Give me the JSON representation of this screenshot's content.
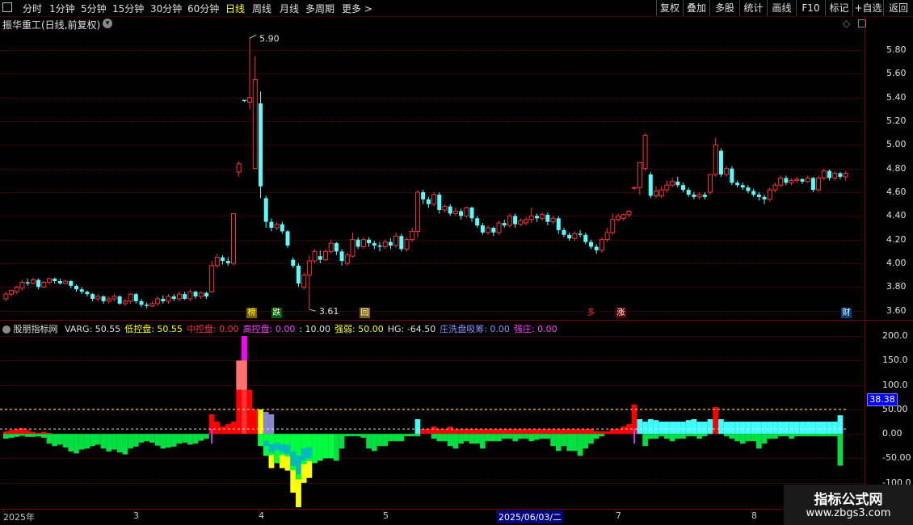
{
  "toolbar": {
    "tabs": [
      "分时",
      "1分钟",
      "5分钟",
      "15分钟",
      "30分钟",
      "60分钟",
      "日线",
      "周线",
      "月线",
      "多周期",
      "更多 >"
    ],
    "active_tab": "日线",
    "right_buttons": [
      "复权",
      "叠加",
      "多股",
      "统计",
      "画线",
      "F10",
      "标记",
      "+自选",
      "返回"
    ]
  },
  "chart_title": "振华重工(日线,前复权)",
  "price_axis": [
    "5.80",
    "5.60",
    "5.40",
    "5.20",
    "5.00",
    "4.80",
    "4.60",
    "4.40",
    "4.20",
    "4.00",
    "3.80",
    "3.60"
  ],
  "indicator": {
    "name": "股朋指标网",
    "items": [
      {
        "label": "VARG: 50.55",
        "color": "#e0e0e0"
      },
      {
        "label": "低控盘: 50.55",
        "color": "#ffff00"
      },
      {
        "label": "中控盘: 0.00",
        "color": "#ff3030"
      },
      {
        "label": "高控盘: 0.00",
        "color": "#ff40ff"
      },
      {
        "label": ": 10.00",
        "color": "#e0e0e0"
      },
      {
        "label": "强弱: 50.00",
        "color": "#ffff00"
      },
      {
        "label": "HG: -64.50",
        "color": "#e0e0e0"
      },
      {
        "label": "庄洗盘吸筹: 0.00",
        "color": "#9090ff"
      },
      {
        "label": "强庄: 0.00",
        "color": "#ff40ff"
      }
    ],
    "axis": [
      "200.0",
      "150.0",
      "100.0",
      "50.00",
      "0.00",
      "-50.00",
      "-100.0"
    ],
    "current_value": "38.38"
  },
  "markers": {
    "high": "5.90",
    "low": "3.61"
  },
  "event_tags": [
    {
      "text": "榜",
      "bg": "#806000",
      "color": "#ffff00"
    },
    {
      "text": "跌",
      "bg": "#006000",
      "color": "#ffffff"
    },
    {
      "text": "回",
      "bg": "#806000",
      "color": "#ffffff"
    },
    {
      "text": "多",
      "bg": "#000000",
      "color": "#ff3030"
    },
    {
      "text": "涨",
      "bg": "#600000",
      "color": "#ffffff"
    },
    {
      "text": "财",
      "bg": "#004080",
      "color": "#ffffff"
    }
  ],
  "date_axis": [
    "2025年",
    "3",
    "4",
    "5",
    "2025/06/03/二",
    "7",
    "8"
  ],
  "watermark": {
    "line1": "指标公式网",
    "line2": "www.zbgs3.com"
  },
  "chart_data": {
    "type": "candlestick",
    "price_range": [
      3.55,
      5.95
    ],
    "candles": [
      [
        3.7,
        3.74,
        3.68,
        3.76
      ],
      [
        3.74,
        3.77,
        3.72,
        3.78
      ],
      [
        3.76,
        3.8,
        3.74,
        3.81
      ],
      [
        3.79,
        3.84,
        3.77,
        3.86
      ],
      [
        3.84,
        3.83,
        3.81,
        3.87
      ],
      [
        3.83,
        3.86,
        3.82,
        3.88
      ],
      [
        3.86,
        3.8,
        3.78,
        3.87
      ],
      [
        3.8,
        3.84,
        3.79,
        3.85
      ],
      [
        3.84,
        3.87,
        3.82,
        3.88
      ],
      [
        3.87,
        3.85,
        3.83,
        3.88
      ],
      [
        3.85,
        3.83,
        3.82,
        3.87
      ],
      [
        3.83,
        3.85,
        3.82,
        3.86
      ],
      [
        3.85,
        3.81,
        3.79,
        3.86
      ],
      [
        3.81,
        3.78,
        3.76,
        3.82
      ],
      [
        3.78,
        3.76,
        3.74,
        3.8
      ],
      [
        3.76,
        3.74,
        3.72,
        3.77
      ],
      [
        3.74,
        3.7,
        3.68,
        3.75
      ],
      [
        3.7,
        3.72,
        3.68,
        3.74
      ],
      [
        3.72,
        3.68,
        3.66,
        3.73
      ],
      [
        3.68,
        3.7,
        3.66,
        3.72
      ],
      [
        3.7,
        3.72,
        3.68,
        3.74
      ],
      [
        3.72,
        3.66,
        3.65,
        3.73
      ],
      [
        3.66,
        3.68,
        3.64,
        3.7
      ],
      [
        3.68,
        3.74,
        3.66,
        3.75
      ],
      [
        3.74,
        3.68,
        3.66,
        3.75
      ],
      [
        3.68,
        3.65,
        3.63,
        3.7
      ],
      [
        3.65,
        3.64,
        3.62,
        3.67
      ],
      [
        3.64,
        3.66,
        3.63,
        3.68
      ],
      [
        3.66,
        3.7,
        3.64,
        3.72
      ],
      [
        3.7,
        3.68,
        3.66,
        3.73
      ],
      [
        3.68,
        3.72,
        3.66,
        3.74
      ],
      [
        3.72,
        3.7,
        3.68,
        3.74
      ],
      [
        3.7,
        3.74,
        3.68,
        3.76
      ],
      [
        3.74,
        3.7,
        3.69,
        3.76
      ],
      [
        3.7,
        3.76,
        3.68,
        3.78
      ],
      [
        3.76,
        3.72,
        3.7,
        3.77
      ],
      [
        3.72,
        3.75,
        3.7,
        3.76
      ],
      [
        3.75,
        3.72,
        3.7,
        3.76
      ],
      [
        3.76,
        3.98,
        3.75,
        4.02
      ],
      [
        3.98,
        4.05,
        3.96,
        4.08
      ],
      [
        4.05,
        4.02,
        3.99,
        4.07
      ],
      [
        4.02,
        4.0,
        3.98,
        4.05
      ],
      [
        4.0,
        4.42,
        3.98,
        4.42
      ],
      [
        4.77,
        4.84,
        4.73,
        4.86
      ],
      [
        5.38,
        5.37,
        5.36,
        5.38
      ],
      [
        5.36,
        5.4,
        5.3,
        5.9
      ],
      [
        4.8,
        5.55,
        4.8,
        5.75
      ],
      [
        5.35,
        4.65,
        4.55,
        5.45
      ],
      [
        4.55,
        4.35,
        4.3,
        4.57
      ],
      [
        4.35,
        4.3,
        4.27,
        4.38
      ],
      [
        4.3,
        4.33,
        4.28,
        4.35
      ],
      [
        4.33,
        4.27,
        4.25,
        4.35
      ],
      [
        4.27,
        4.15,
        4.13,
        4.28
      ],
      [
        4.03,
        3.98,
        3.96,
        4.05
      ],
      [
        3.98,
        3.83,
        3.8,
        4.0
      ],
      [
        3.8,
        3.9,
        3.78,
        3.92
      ],
      [
        3.9,
        4.02,
        3.61,
        4.07
      ],
      [
        4.02,
        4.1,
        4.0,
        4.12
      ],
      [
        4.06,
        4.03,
        4.0,
        4.11
      ],
      [
        4.03,
        4.1,
        4.02,
        4.12
      ],
      [
        4.1,
        4.17,
        4.08,
        4.2
      ],
      [
        4.17,
        4.1,
        4.07,
        4.18
      ],
      [
        4.1,
        4.02,
        3.98,
        4.12
      ],
      [
        4.0,
        4.07,
        3.98,
        4.09
      ],
      [
        4.06,
        4.2,
        4.05,
        4.26
      ],
      [
        4.2,
        4.14,
        4.12,
        4.22
      ],
      [
        4.14,
        4.2,
        4.12,
        4.22
      ],
      [
        4.2,
        4.17,
        4.14,
        4.22
      ],
      [
        4.17,
        4.15,
        4.12,
        4.19
      ],
      [
        4.15,
        4.14,
        4.1,
        4.18
      ],
      [
        4.14,
        4.18,
        4.12,
        4.2
      ],
      [
        4.18,
        4.15,
        4.12,
        4.21
      ],
      [
        4.15,
        4.23,
        4.13,
        4.26
      ],
      [
        4.23,
        4.12,
        4.1,
        4.25
      ],
      [
        4.12,
        4.2,
        4.1,
        4.22
      ],
      [
        4.2,
        4.27,
        4.18,
        4.3
      ],
      [
        4.27,
        4.6,
        4.22,
        4.62
      ],
      [
        4.6,
        4.54,
        4.5,
        4.62
      ],
      [
        4.54,
        4.5,
        4.47,
        4.56
      ],
      [
        4.5,
        4.58,
        4.48,
        4.6
      ],
      [
        4.58,
        4.45,
        4.42,
        4.6
      ],
      [
        4.45,
        4.48,
        4.43,
        4.5
      ],
      [
        4.48,
        4.42,
        4.4,
        4.5
      ],
      [
        4.42,
        4.44,
        4.4,
        4.47
      ],
      [
        4.44,
        4.4,
        4.37,
        4.46
      ],
      [
        4.4,
        4.47,
        4.38,
        4.48
      ],
      [
        4.47,
        4.38,
        4.35,
        4.48
      ],
      [
        4.38,
        4.32,
        4.3,
        4.4
      ],
      [
        4.32,
        4.26,
        4.24,
        4.34
      ],
      [
        4.26,
        4.3,
        4.24,
        4.32
      ],
      [
        4.3,
        4.26,
        4.23,
        4.31
      ],
      [
        4.26,
        4.34,
        4.24,
        4.36
      ],
      [
        4.34,
        4.32,
        4.3,
        4.37
      ],
      [
        4.32,
        4.4,
        4.3,
        4.42
      ],
      [
        4.4,
        4.33,
        4.3,
        4.42
      ],
      [
        4.33,
        4.36,
        4.31,
        4.38
      ],
      [
        4.34,
        4.37,
        4.32,
        4.39
      ],
      [
        4.37,
        4.4,
        4.34,
        4.47
      ],
      [
        4.4,
        4.38,
        4.35,
        4.42
      ],
      [
        4.38,
        4.41,
        4.36,
        4.43
      ],
      [
        4.41,
        4.35,
        4.32,
        4.43
      ],
      [
        4.35,
        4.38,
        4.33,
        4.4
      ],
      [
        4.38,
        4.28,
        4.25,
        4.4
      ],
      [
        4.28,
        4.24,
        4.22,
        4.3
      ],
      [
        4.24,
        4.21,
        4.19,
        4.26
      ],
      [
        4.21,
        4.25,
        4.19,
        4.27
      ],
      [
        4.25,
        4.24,
        4.22,
        4.28
      ],
      [
        4.24,
        4.18,
        4.16,
        4.26
      ],
      [
        4.18,
        4.14,
        4.12,
        4.2
      ],
      [
        4.14,
        4.11,
        4.08,
        4.16
      ],
      [
        4.11,
        4.2,
        4.09,
        4.22
      ],
      [
        4.2,
        4.26,
        4.18,
        4.3
      ],
      [
        4.26,
        4.37,
        4.24,
        4.42
      ],
      [
        4.37,
        4.4,
        4.35,
        4.42
      ],
      [
        4.38,
        4.41,
        4.36,
        4.42
      ],
      [
        4.41,
        4.44,
        4.39,
        4.45
      ],
      [
        4.64,
        4.64,
        4.62,
        4.64
      ],
      [
        4.64,
        4.85,
        4.58,
        4.85
      ],
      [
        4.8,
        5.08,
        4.78,
        5.1
      ],
      [
        4.75,
        4.57,
        4.55,
        4.77
      ],
      [
        4.57,
        4.61,
        4.55,
        4.65
      ],
      [
        4.57,
        4.62,
        4.55,
        4.65
      ],
      [
        4.62,
        4.66,
        4.6,
        4.7
      ],
      [
        4.66,
        4.69,
        4.64,
        4.72
      ],
      [
        4.69,
        4.66,
        4.64,
        4.73
      ],
      [
        4.66,
        4.62,
        4.6,
        4.68
      ],
      [
        4.62,
        4.58,
        4.56,
        4.64
      ],
      [
        4.58,
        4.56,
        4.54,
        4.6
      ],
      [
        4.56,
        4.58,
        4.54,
        4.6
      ],
      [
        4.58,
        4.56,
        4.54,
        4.6
      ],
      [
        4.6,
        4.75,
        4.58,
        4.75
      ],
      [
        4.75,
        5.0,
        4.73,
        5.06
      ],
      [
        4.95,
        4.75,
        4.73,
        4.97
      ],
      [
        4.75,
        4.8,
        4.73,
        4.82
      ],
      [
        4.8,
        4.68,
        4.66,
        4.82
      ],
      [
        4.68,
        4.66,
        4.64,
        4.7
      ],
      [
        4.66,
        4.64,
        4.62,
        4.68
      ],
      [
        4.64,
        4.61,
        4.59,
        4.66
      ],
      [
        4.61,
        4.58,
        4.56,
        4.63
      ],
      [
        4.58,
        4.56,
        4.53,
        4.6
      ],
      [
        4.56,
        4.54,
        4.5,
        4.58
      ],
      [
        4.54,
        4.62,
        4.52,
        4.64
      ],
      [
        4.62,
        4.66,
        4.6,
        4.68
      ],
      [
        4.66,
        4.72,
        4.64,
        4.74
      ],
      [
        4.72,
        4.68,
        4.66,
        4.74
      ],
      [
        4.68,
        4.7,
        4.66,
        4.72
      ],
      [
        4.7,
        4.71,
        4.68,
        4.73
      ],
      [
        4.71,
        4.69,
        4.67,
        4.72
      ],
      [
        4.69,
        4.72,
        4.68,
        4.74
      ],
      [
        4.72,
        4.62,
        4.6,
        4.73
      ],
      [
        4.62,
        4.72,
        4.6,
        4.74
      ],
      [
        4.72,
        4.78,
        4.7,
        4.8
      ],
      [
        4.78,
        4.72,
        4.7,
        4.79
      ],
      [
        4.72,
        4.76,
        4.7,
        4.78
      ],
      [
        4.76,
        4.73,
        4.71,
        4.77
      ],
      [
        4.73,
        4.76,
        4.7,
        4.78
      ]
    ],
    "indicator_range": [
      -150,
      210
    ],
    "bars": [
      [
        5,
        -10
      ],
      [
        8,
        -8
      ],
      [
        10,
        -6
      ],
      [
        12,
        -4
      ],
      [
        8,
        -6
      ],
      [
        4,
        -6
      ],
      [
        2,
        -5
      ],
      [
        4,
        -8
      ],
      [
        2,
        -20
      ],
      [
        0,
        -25
      ],
      [
        0,
        -22
      ],
      [
        0,
        -28
      ],
      [
        0,
        -36
      ],
      [
        0,
        -40
      ],
      [
        0,
        -32
      ],
      [
        0,
        -30
      ],
      [
        0,
        -25
      ],
      [
        0,
        -22
      ],
      [
        0,
        -30
      ],
      [
        0,
        -36
      ],
      [
        0,
        -32
      ],
      [
        0,
        -38
      ],
      [
        0,
        -42
      ],
      [
        0,
        -30
      ],
      [
        0,
        -26
      ],
      [
        0,
        -18
      ],
      [
        0,
        -15
      ],
      [
        0,
        -18
      ],
      [
        0,
        -24
      ],
      [
        0,
        -30
      ],
      [
        0,
        -28
      ],
      [
        0,
        -26
      ],
      [
        0,
        -20
      ],
      [
        0,
        -18
      ],
      [
        0,
        -22
      ],
      [
        0,
        -20
      ],
      [
        0,
        -14
      ],
      [
        0,
        -10
      ],
      [
        40,
        0
      ],
      [
        25,
        0
      ],
      [
        15,
        0
      ],
      [
        20,
        0
      ],
      [
        25,
        0
      ],
      [
        90,
        0
      ],
      [
        200,
        0
      ],
      [
        90,
        0
      ],
      [
        50,
        0
      ],
      [
        50,
        -25
      ],
      [
        45,
        -45
      ],
      [
        40,
        -70
      ],
      [
        0,
        -60
      ],
      [
        0,
        -70
      ],
      [
        0,
        -75
      ],
      [
        0,
        -120
      ],
      [
        0,
        -150
      ],
      [
        0,
        -100
      ],
      [
        0,
        -90
      ],
      [
        0,
        -60
      ],
      [
        0,
        -55
      ],
      [
        0,
        -50
      ],
      [
        0,
        -50
      ],
      [
        0,
        -55
      ],
      [
        0,
        -30
      ],
      [
        0,
        -5
      ],
      [
        0,
        -5
      ],
      [
        0,
        -5
      ],
      [
        0,
        -8
      ],
      [
        0,
        -30
      ],
      [
        0,
        -35
      ],
      [
        0,
        -25
      ],
      [
        0,
        -25
      ],
      [
        0,
        -15
      ],
      [
        0,
        -15
      ],
      [
        0,
        -15
      ],
      [
        0,
        -5
      ],
      [
        0,
        -5
      ],
      [
        30,
        -5
      ],
      [
        10,
        0
      ],
      [
        10,
        0
      ],
      [
        15,
        -10
      ],
      [
        10,
        -15
      ],
      [
        10,
        -15
      ],
      [
        15,
        -25
      ],
      [
        10,
        -30
      ],
      [
        10,
        -20
      ],
      [
        10,
        -15
      ],
      [
        10,
        -20
      ],
      [
        10,
        -20
      ],
      [
        10,
        -30
      ],
      [
        10,
        -15
      ],
      [
        10,
        -15
      ],
      [
        10,
        -15
      ],
      [
        10,
        -10
      ],
      [
        10,
        -10
      ],
      [
        10,
        -15
      ],
      [
        10,
        -10
      ],
      [
        10,
        -10
      ],
      [
        10,
        -15
      ],
      [
        10,
        -12
      ],
      [
        10,
        -10
      ],
      [
        10,
        -10
      ],
      [
        10,
        -25
      ],
      [
        10,
        -35
      ],
      [
        10,
        -25
      ],
      [
        10,
        -35
      ],
      [
        10,
        -35
      ],
      [
        10,
        -45
      ],
      [
        10,
        -30
      ],
      [
        10,
        -20
      ],
      [
        5,
        -10
      ],
      [
        5,
        -5
      ],
      [
        5,
        0
      ],
      [
        10,
        0
      ],
      [
        10,
        0
      ],
      [
        15,
        0
      ],
      [
        20,
        0
      ],
      [
        60,
        0
      ],
      [
        30,
        0
      ],
      [
        25,
        -25
      ],
      [
        30,
        -10
      ],
      [
        28,
        -10
      ],
      [
        25,
        -5
      ],
      [
        25,
        -10
      ],
      [
        25,
        -15
      ],
      [
        25,
        -10
      ],
      [
        25,
        -10
      ],
      [
        28,
        -5
      ],
      [
        30,
        -5
      ],
      [
        25,
        -10
      ],
      [
        25,
        -5
      ],
      [
        30,
        0
      ],
      [
        55,
        0
      ],
      [
        30,
        0
      ],
      [
        25,
        -5
      ],
      [
        25,
        -10
      ],
      [
        25,
        -15
      ],
      [
        25,
        -20
      ],
      [
        25,
        -15
      ],
      [
        25,
        -15
      ],
      [
        25,
        -30
      ],
      [
        25,
        -20
      ],
      [
        25,
        -10
      ],
      [
        25,
        -10
      ],
      [
        25,
        -5
      ],
      [
        25,
        -5
      ],
      [
        25,
        -10
      ],
      [
        25,
        -5
      ],
      [
        25,
        -5
      ],
      [
        25,
        -5
      ],
      [
        25,
        -5
      ],
      [
        25,
        -5
      ],
      [
        25,
        -5
      ],
      [
        25,
        -5
      ],
      [
        25,
        -5
      ],
      [
        38,
        -65
      ]
    ],
    "dashed_levels": [
      50,
      10
    ]
  }
}
